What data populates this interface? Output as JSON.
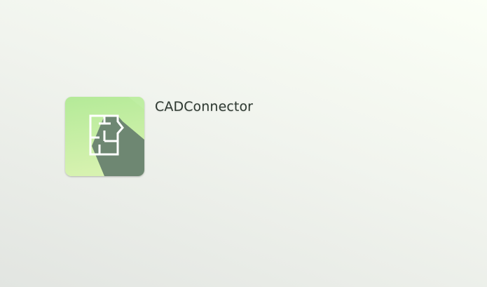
{
  "desktop": {
    "apps": [
      {
        "name": "CADConnector",
        "icon": "floor-plan-icon",
        "icon_colors": {
          "gradient_top": "#b6ec99",
          "gradient_bottom": "#d4f1ae",
          "shadow": "#6e8772",
          "plan_stroke": "#ffffff"
        }
      }
    ]
  }
}
